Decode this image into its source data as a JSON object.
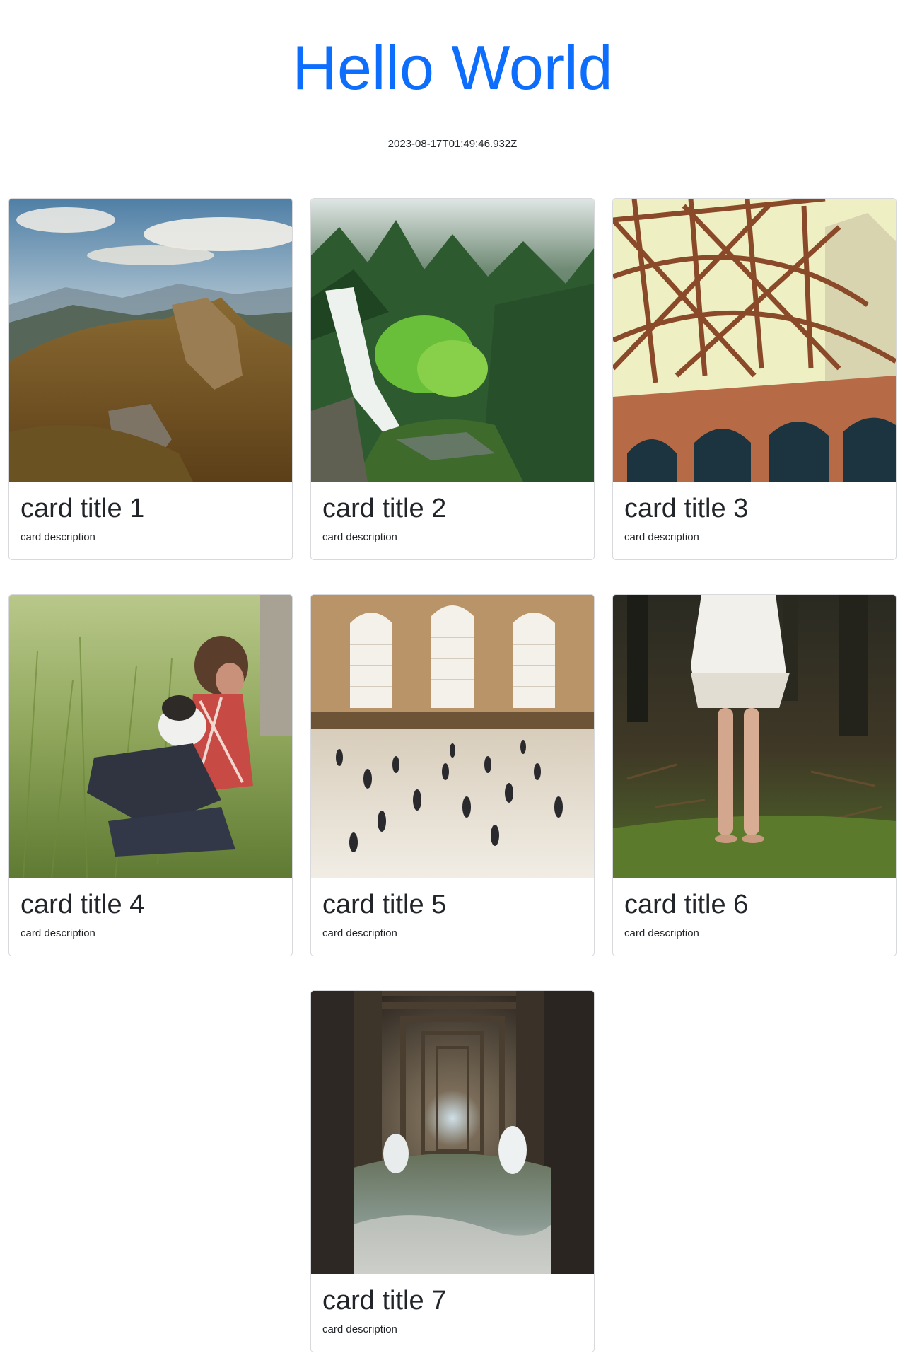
{
  "header": {
    "title": "Hello World",
    "timestamp": "2023-08-17T01:49:46.932Z",
    "title_color": "#0d6efd"
  },
  "cards": [
    {
      "title": "card title 1",
      "description": "card description",
      "image": "mountain-landscape"
    },
    {
      "title": "card title 2",
      "description": "card description",
      "image": "waterfall-forest"
    },
    {
      "title": "card title 3",
      "description": "card description",
      "image": "bridge-arches"
    },
    {
      "title": "card title 4",
      "description": "card description",
      "image": "man-with-dog-in-grass"
    },
    {
      "title": "card title 5",
      "description": "card description",
      "image": "train-station-crowd"
    },
    {
      "title": "card title 6",
      "description": "card description",
      "image": "woman-white-dress-forest"
    },
    {
      "title": "card title 7",
      "description": "card description",
      "image": "under-pier-waves"
    }
  ]
}
